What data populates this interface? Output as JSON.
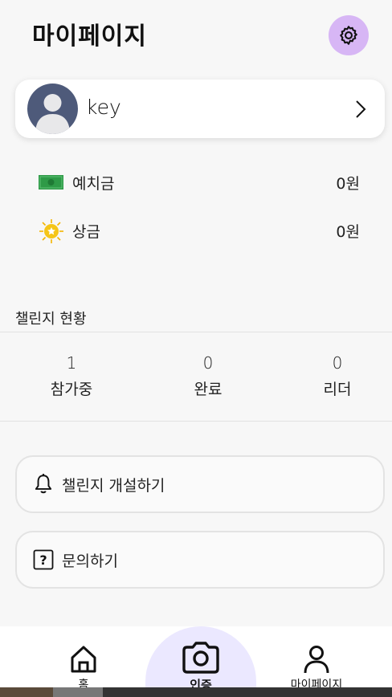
{
  "header": {
    "title": "마이페이지",
    "settings_icon": "gear-icon"
  },
  "profile": {
    "name": "key"
  },
  "wallet": {
    "deposit": {
      "label": "예치금",
      "value": "0원",
      "icon": "money-icon"
    },
    "prize": {
      "label": "상금",
      "value": "0원",
      "icon": "sun-medal-icon"
    }
  },
  "challenge_status": {
    "title": "챌린지 현황",
    "stats": [
      {
        "count": "1",
        "label": "참가중"
      },
      {
        "count": "0",
        "label": "완료"
      },
      {
        "count": "0",
        "label": "리더"
      }
    ]
  },
  "actions": [
    {
      "label": "챌린지 개설하기",
      "icon": "bell-icon"
    },
    {
      "label": "문의하기",
      "icon": "question-icon"
    }
  ],
  "tabbar": {
    "home": "홈",
    "certify": "인증",
    "mypage": "마이페이지"
  },
  "colors": {
    "accent": "#d7b6f5",
    "camera_bg": "#ebe8ff",
    "avatar_bg": "#4e5a7a"
  }
}
